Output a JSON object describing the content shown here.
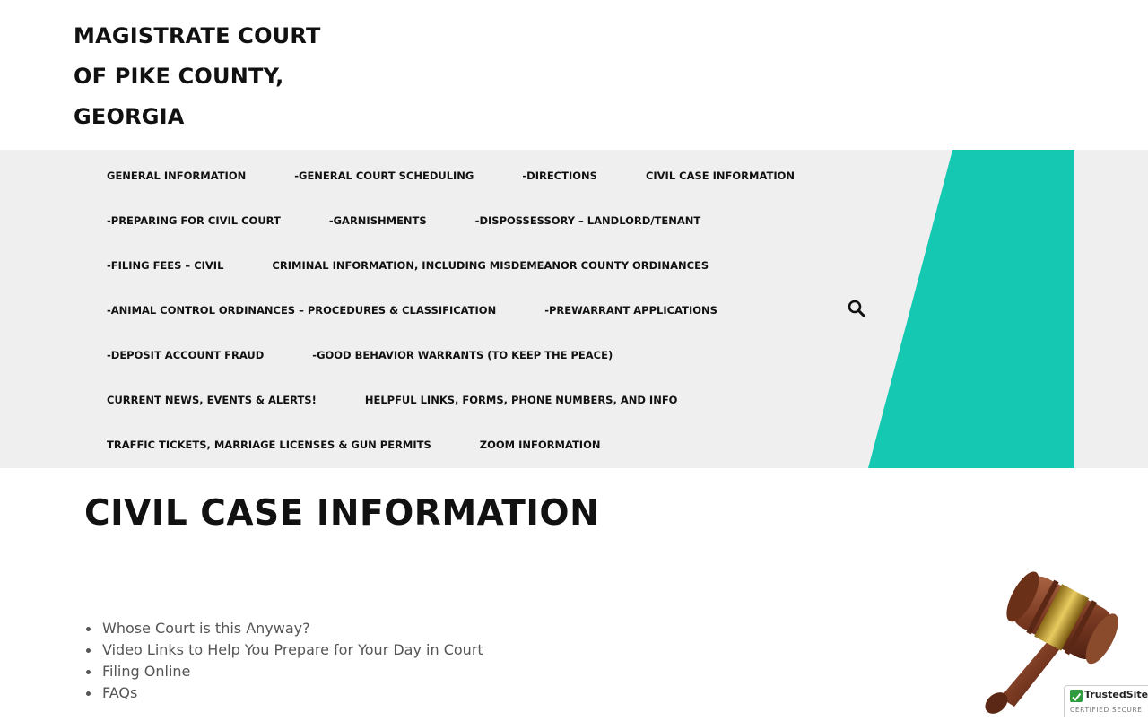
{
  "header": {
    "site_title_lines": [
      "MAGISTRATE COURT",
      "OF PIKE COUNTY,",
      "GEORGIA"
    ]
  },
  "nav": {
    "rows": [
      [
        "GENERAL INFORMATION",
        "-GENERAL COURT SCHEDULING",
        "-DIRECTIONS",
        "CIVIL CASE INFORMATION"
      ],
      [
        "-PREPARING FOR CIVIL COURT",
        "-GARNISHMENTS",
        "-DISPOSSESSORY – LANDLORD/TENANT"
      ],
      [
        "-FILING FEES – CIVIL",
        "CRIMINAL INFORMATION, INCLUDING MISDEMEANOR COUNTY ORDINANCES"
      ],
      [
        "-ANIMAL CONTROL ORDINANCES – PROCEDURES & CLASSIFICATION",
        "-PREWARRANT APPLICATIONS"
      ],
      [
        "-DEPOSIT ACCOUNT FRAUD",
        "-GOOD BEHAVIOR WARRANTS (TO KEEP THE PEACE)"
      ],
      [
        "CURRENT NEWS, EVENTS & ALERTS!",
        "HELPFUL LINKS, FORMS, PHONE NUMBERS, AND INFO"
      ],
      [
        "TRAFFIC TICKETS, MARRIAGE LICENSES & GUN PERMITS",
        "ZOOM INFORMATION"
      ]
    ],
    "search_icon": "search-icon",
    "accent_color": "#14c8b2",
    "background_color": "#efefef"
  },
  "main": {
    "page_title": "CIVIL CASE INFORMATION",
    "links": [
      "Whose Court is this Anyway?",
      "Video Links to Help You Prepare for Your Day in Court",
      "Filing Online",
      "FAQs"
    ],
    "image_icon": "gavel-icon"
  },
  "badge": {
    "name": "TrustedSite",
    "subtitle": "CERTIFIED SECURE"
  }
}
